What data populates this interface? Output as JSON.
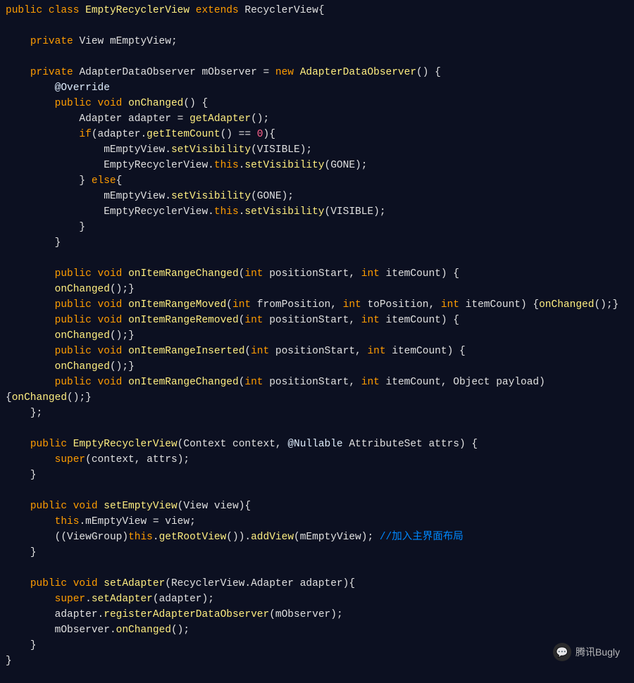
{
  "code": {
    "outer": [
      "public",
      "class",
      "EmptyRecyclerView",
      "extends",
      "RecyclerView",
      "{"
    ],
    "field1": [
      "private",
      "View mEmptyView",
      ";"
    ],
    "field2a": [
      "private",
      "AdapterDataObserver mObserver ",
      "=",
      "new",
      "AdapterDataObserver",
      "()",
      " {"
    ],
    "override": "@Override",
    "onChanged_sig": [
      "public",
      "void",
      "onChanged",
      "()",
      " {"
    ],
    "onChanged_l1": [
      "Adapter adapter ",
      "=",
      "getAdapter",
      "()",
      ";"
    ],
    "onChanged_if": [
      "if",
      "(",
      "adapter",
      ".",
      "getItemCount",
      "()",
      " == ",
      "0",
      ")",
      "{"
    ],
    "onChanged_if_l1": [
      "mEmptyView",
      ".",
      "setVisibility",
      "(",
      "VISIBLE",
      ")",
      ";"
    ],
    "onChanged_if_l2": [
      "EmptyRecyclerView",
      ".",
      "this",
      ".",
      "setVisibility",
      "(",
      "GONE",
      ")",
      ";"
    ],
    "else": [
      "}",
      " else",
      "{"
    ],
    "onChanged_else_l1": [
      "mEmptyView",
      ".",
      "setVisibility",
      "(",
      "GONE",
      ")",
      ";"
    ],
    "onChanged_else_l2": [
      "EmptyRecyclerView",
      ".",
      "this",
      ".",
      "setVisibility",
      "(",
      "VISIBLE",
      ")",
      ";"
    ],
    "rc_sig": [
      "public",
      "void",
      "onItemRangeChanged",
      "(",
      "int",
      " positionStart",
      ", ",
      "int",
      " itemCount",
      ")",
      " {"
    ],
    "rc_body": [
      "onChanged",
      "()",
      ";",
      "}"
    ],
    "rm_sig": [
      "public",
      "void",
      "onItemRangeMoved",
      "(",
      "int",
      " fromPosition",
      ", ",
      "int",
      " toPosition",
      ", ",
      "int",
      " itemCount",
      ")",
      " {",
      "onChanged",
      "()",
      ";",
      "}"
    ],
    "rr_sig": [
      "public",
      "void",
      "onItemRangeRemoved",
      "(",
      "int",
      " positionStart",
      ", ",
      "int",
      " itemCount",
      ")",
      " {"
    ],
    "rr_body": [
      "onChanged",
      "()",
      ";",
      "}"
    ],
    "ri_sig": [
      "public",
      "void",
      "onItemRangeInserted",
      "(",
      "int",
      " positionStart",
      ", ",
      "int",
      " itemCount",
      ")",
      " {"
    ],
    "ri_body": [
      "onChanged",
      "()",
      ";",
      "}"
    ],
    "rc2_sig": [
      "public",
      "void",
      "onItemRangeChanged",
      "(",
      "int",
      " positionStart",
      ", ",
      "int",
      " itemCount",
      ", ",
      "Object payload",
      ")",
      " {",
      "onChanged",
      "()",
      ";",
      "}"
    ],
    "ctor_sig": [
      "public",
      "EmptyRecyclerView",
      "(",
      "Context context",
      ", ",
      "@Nullable",
      " AttributeSet attrs",
      ")",
      " {"
    ],
    "ctor_body": [
      "super",
      "(",
      "context",
      ", ",
      "attrs",
      ")",
      ";"
    ],
    "sev_sig": [
      "public",
      "void",
      "setEmptyView",
      "(",
      "View view",
      ")",
      "{"
    ],
    "sev_l1": [
      "this",
      ".",
      "mEmptyView ",
      "=",
      " view",
      ";"
    ],
    "sev_l2a": [
      "(",
      "(",
      "ViewGroup",
      ")",
      "this",
      ".",
      "getRootView",
      "()",
      ")",
      ".",
      "addView",
      "(",
      "mEmptyView",
      ")",
      ";",
      " "
    ],
    "sev_comment": "//加入主界面布局",
    "sa_sig": [
      "public",
      "void",
      "setAdapter",
      "(",
      "RecyclerView",
      ".",
      "Adapter adapter",
      ")",
      "{"
    ],
    "sa_l1": [
      "super",
      ".",
      "setAdapter",
      "(",
      "adapter",
      ")",
      ";"
    ],
    "sa_l2": [
      "adapter",
      ".",
      "registerAdapterDataObserver",
      "(",
      "mObserver",
      ")",
      ";"
    ],
    "sa_l3": [
      "mObserver",
      ".",
      "onChanged",
      "()",
      ";"
    ]
  },
  "watermark": {
    "icon_glyph": "💬",
    "text": "腾讯Bugly"
  }
}
